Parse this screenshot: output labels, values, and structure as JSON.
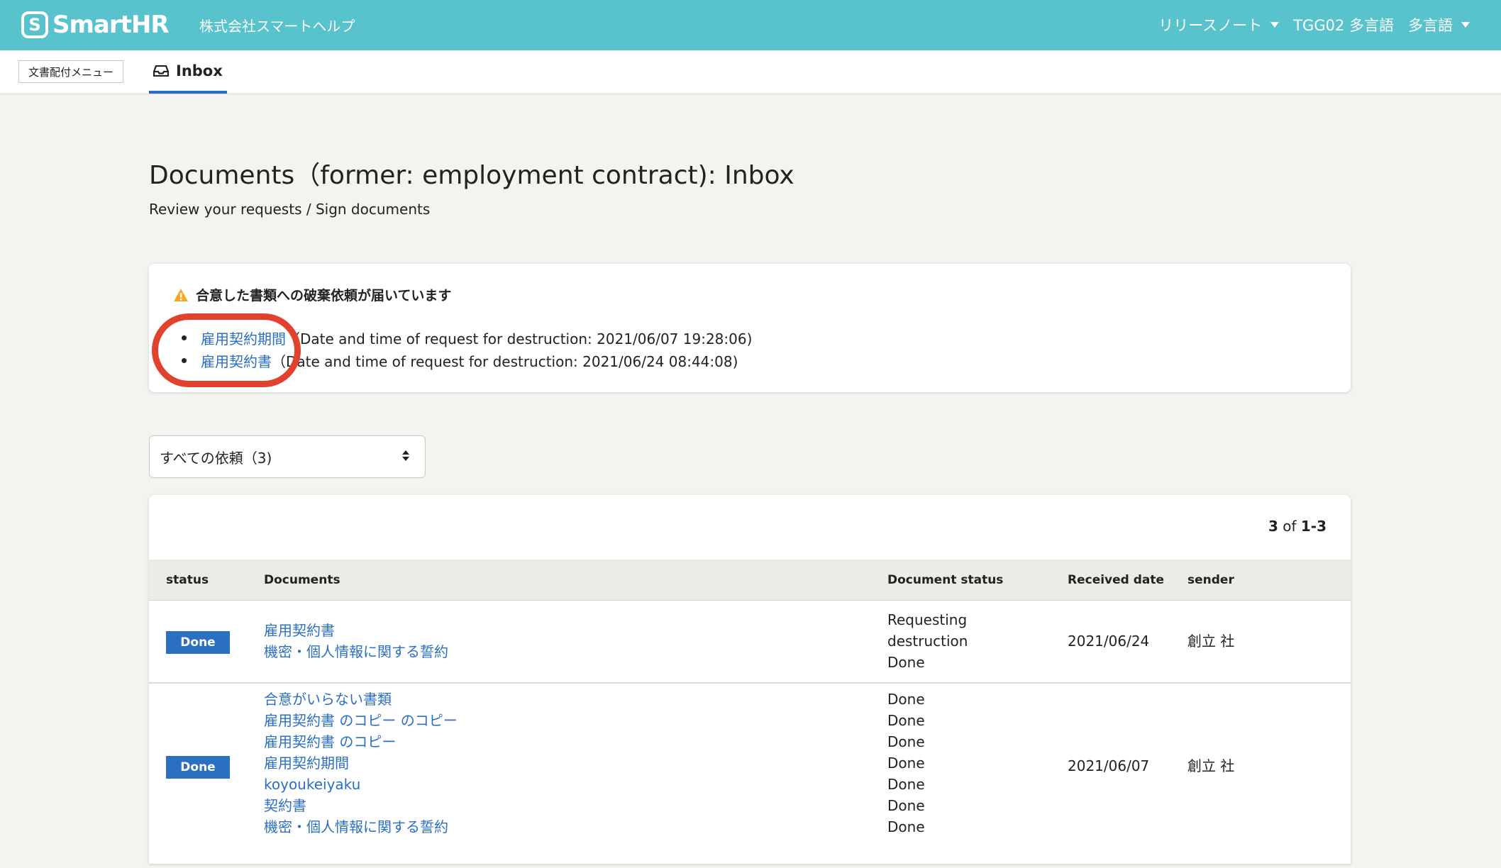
{
  "header": {
    "logo_mark": "S",
    "logo_text": "SmartHR",
    "company": "株式会社スマートヘルプ",
    "nav": [
      "リリースノート",
      "TGG02 多言語",
      "多言語"
    ]
  },
  "tabs": {
    "doc_menu": "文書配付メニュー",
    "inbox": "Inbox"
  },
  "page": {
    "title": "Documents（former: employment contract): Inbox",
    "subtitle": "Review your requests / Sign documents"
  },
  "alert": {
    "heading": "合意した書類への破棄依頼が届いています",
    "items": [
      {
        "link": "雇用契約期間",
        "text": "（Date and time of request for destruction: 2021/06/07 19:28:06)"
      },
      {
        "link": "雇用契約書",
        "text": "（Date and time of request for destruction: 2021/06/24 08:44:08)"
      }
    ]
  },
  "filter": {
    "selected": "すべての依頼（3)"
  },
  "table": {
    "count_bold": "3",
    "count_of": "of",
    "count_range": "1-3",
    "headers": {
      "status": "status",
      "documents": "Documents",
      "document_status": "Document status",
      "received_date": "Received date",
      "sender": "sender"
    },
    "rows": [
      {
        "status": "Done",
        "documents": [
          "雇用契約書",
          "機密・個人情報に関する誓約"
        ],
        "document_status": [
          "Requesting",
          "destruction",
          "Done"
        ],
        "received_date": "2021/06/24",
        "sender": "創立 社"
      },
      {
        "status": "Done",
        "documents": [
          "合意がいらない書類",
          "雇用契約書 のコピー のコピー",
          "雇用契約書 のコピー",
          "雇用契約期間",
          "koyoukeiyaku",
          "契約書",
          "機密・個人情報に関する誓約"
        ],
        "document_status": [
          "Done",
          "Done",
          "Done",
          "Done",
          "Done",
          "Done",
          "Done"
        ],
        "received_date": "2021/06/07",
        "sender": "創立 社"
      }
    ]
  },
  "colors": {
    "header_bg": "#58c2cd",
    "link": "#2b6fc1",
    "badge": "#2b6fc1",
    "annotation_circle": "#e2412e",
    "warning": "#f5a623"
  }
}
